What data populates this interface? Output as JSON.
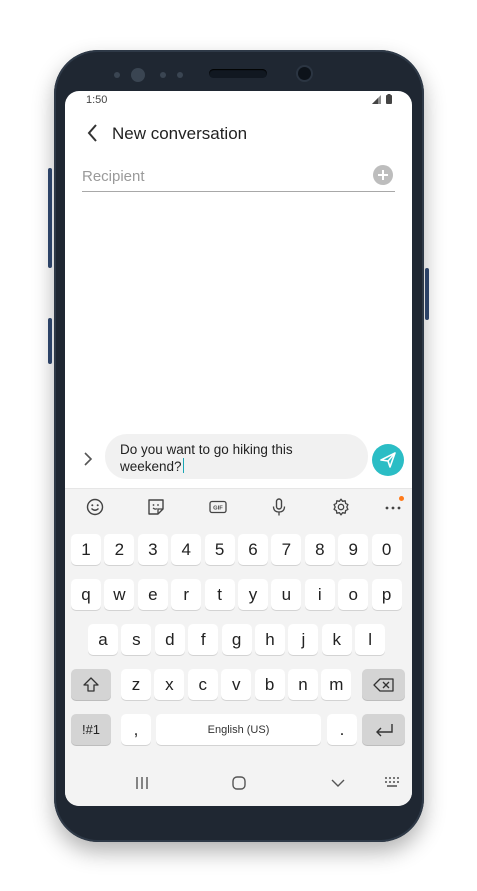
{
  "status_bar": {
    "time": "1:50"
  },
  "header": {
    "title": "New conversation"
  },
  "recipient": {
    "placeholder": "Recipient",
    "value": ""
  },
  "composer": {
    "line1": "Do you want to go hiking this",
    "line2": "weekend?"
  },
  "keyboard": {
    "row_numbers": [
      "1",
      "2",
      "3",
      "4",
      "5",
      "6",
      "7",
      "8",
      "9",
      "0"
    ],
    "row_top": [
      "q",
      "w",
      "e",
      "r",
      "t",
      "y",
      "u",
      "i",
      "o",
      "p"
    ],
    "row_mid": [
      "a",
      "s",
      "d",
      "f",
      "g",
      "h",
      "j",
      "k",
      "l"
    ],
    "row_bottom": [
      "z",
      "x",
      "c",
      "v",
      "b",
      "n",
      "m"
    ],
    "symbols_label": "!#1",
    "comma_label": ",",
    "space_label": "English (US)",
    "period_label": "."
  },
  "colors": {
    "accent": "#2bbdc5",
    "notification_dot": "#ff7a1a",
    "phone_body": "#1f2732"
  },
  "icons": {
    "toolbar": [
      "emoji-icon",
      "sticker-icon",
      "gif-icon",
      "microphone-icon",
      "settings-icon",
      "more-icon"
    ],
    "nav": [
      "recents-icon",
      "home-icon",
      "back-icon",
      "keyboard-switch-icon"
    ]
  }
}
